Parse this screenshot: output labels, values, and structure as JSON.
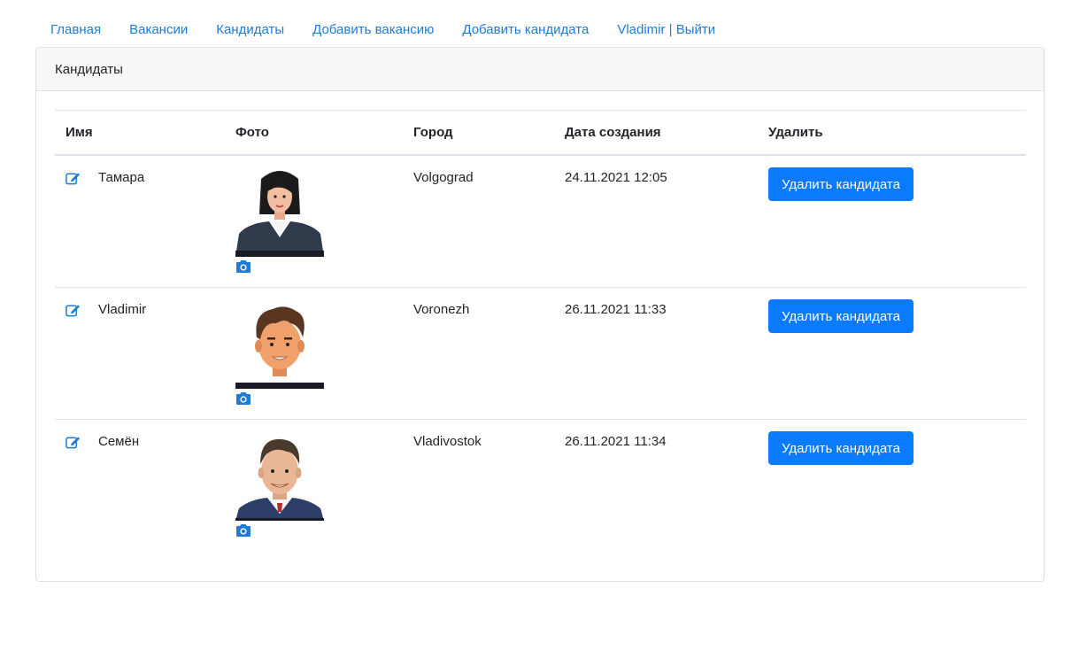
{
  "nav": {
    "items": [
      "Главная",
      "Вакансии",
      "Кандидаты",
      "Добавить вакансию",
      "Добавить кандидата",
      "Vladimir | Выйти"
    ]
  },
  "card": {
    "title": "Кандидаты"
  },
  "table": {
    "headers": {
      "name": "Имя",
      "photo": "Фото",
      "city": "Город",
      "date": "Дата создания",
      "delete": "Удалить"
    },
    "rows": [
      {
        "name": "Тамара",
        "city": "Volgograd",
        "created": "24.11.2021 12:05",
        "delete_label": "Удалить кандидата"
      },
      {
        "name": "Vladimir",
        "city": "Voronezh",
        "created": "26.11.2021 11:33",
        "delete_label": "Удалить кандидата"
      },
      {
        "name": "Семён",
        "city": "Vladivostok",
        "created": "26.11.2021 11:34",
        "delete_label": "Удалить кандидата"
      }
    ]
  },
  "colors": {
    "link": "#1e7bd6",
    "button": "#0a7bff",
    "header_bg": "#f7f7f7"
  },
  "icons": {
    "edit": "edit-icon",
    "camera": "camera-icon"
  }
}
